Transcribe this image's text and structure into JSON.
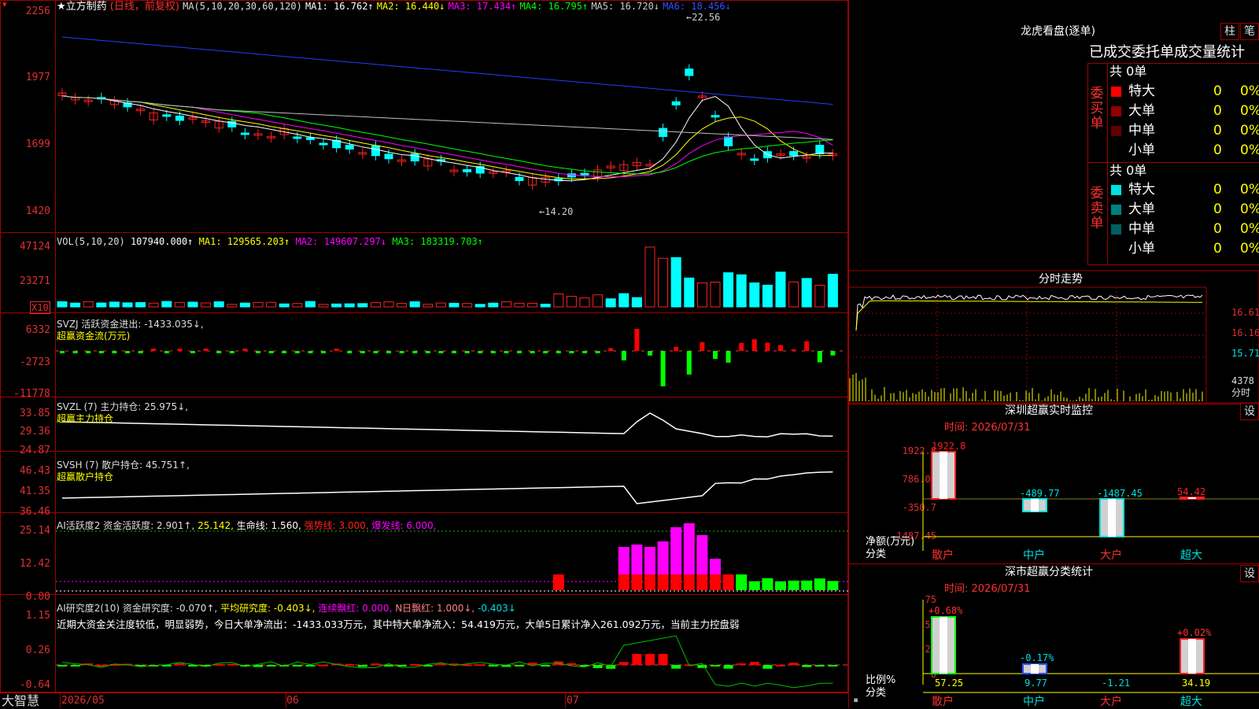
{
  "main_header": {
    "title": "★立方制药",
    "mode": "(日线，前复权)",
    "ma_name": "MA(5,10,20,30,60,120)",
    "ma1": "MA1: 16.762↑",
    "ma2": "MA2: 16.440↓",
    "ma3": "MA3: 17.434↑",
    "ma4": "MA4: 16.795↑",
    "ma5": "MA5: 16.720↓",
    "ma6": "MA6: 18.456↓",
    "high_mark": "22.56",
    "low_mark": "←14.20",
    "y_labels": [
      "2256",
      "1977",
      "1699",
      "1420"
    ]
  },
  "vol_panel": {
    "name": "VOL(5,10,20)",
    "val": "107940.000↑",
    "ma1": "MA1: 129565.203↑",
    "ma2": "MA2: 149607.297↓",
    "ma3": "MA3: 183319.703↑",
    "y_labels": [
      "47124",
      "23271"
    ],
    "unit": "X10"
  },
  "svzj_panel": {
    "line1": "SVZJ  活跃资金进出: -1433.035↓,",
    "line2": "超赢资金流(万元)",
    "y_labels": [
      "6332",
      "-2723",
      "-11778"
    ]
  },
  "svzl_panel": {
    "line1": "SVZL (7) 主力持仓: 25.975↓,",
    "line2": "超赢主力持仓",
    "y_labels": [
      "33.85",
      "29.36",
      "24.87"
    ]
  },
  "svsh_panel": {
    "line1": "SVSH (7) 散户持仓: 45.751↑,",
    "line2": "超赢散户持仓",
    "y_labels": [
      "46.43",
      "41.35",
      "36.46"
    ]
  },
  "ai1_panel": {
    "name": "AI活跃度2 资金活跃度: 2.901↑,",
    "v2": "25.142,",
    "v3": "生命线: 1.560,",
    "v4": "强势线: 3.000,",
    "v5": "爆发线: 6.000,",
    "y_labels": [
      "25.14",
      "12.42",
      "0.00"
    ]
  },
  "ai2_panel": {
    "name": "AI研究度2(10) 资金研究度: -0.070↑,",
    "v2": "平均研究度: -0.403↓,",
    "v3": "连续飘红: 0.000,",
    "v4": "N日飘红: 1.000↓,",
    "v5": "-0.403↓",
    "comment": "近期大资金关注度较低，明显弱势，今日大单净流出：-1433.033万元，其中特大单净流入：54.419万元，大单5日累计净入261.092万元，当前主力控盘弱",
    "y_labels": [
      "1.15",
      "0.26",
      "-0.64"
    ]
  },
  "bottom_bar": {
    "brand": "大智慧",
    "dates": [
      "2026/05",
      "06",
      "07"
    ]
  },
  "lhb": {
    "title": "龙虎看盘(逐单)",
    "btn1": "柱",
    "btn2": "笔",
    "subtitle": "已成交委托单成交量统计",
    "buy_side": "委买单",
    "sell_side": "委卖单",
    "buy_total": "共 0单",
    "sell_total": "共 0单",
    "buy_rows": [
      {
        "label": "特大",
        "n": "0",
        "p": "0%",
        "color": "#ff0000"
      },
      {
        "label": "大单",
        "n": "0",
        "p": "0%",
        "color": "#900000"
      },
      {
        "label": "中单",
        "n": "0",
        "p": "0%",
        "color": "#600000"
      },
      {
        "label": "小单",
        "n": "0",
        "p": "0%",
        "color": "#000000"
      }
    ],
    "sell_rows": [
      {
        "label": "特大",
        "n": "0",
        "p": "0%",
        "color": "#00e0e0"
      },
      {
        "label": "大单",
        "n": "0",
        "p": "0%",
        "color": "#008080"
      },
      {
        "label": "中单",
        "n": "0",
        "p": "0%",
        "color": "#006060"
      },
      {
        "label": "小单",
        "n": "0",
        "p": "0%",
        "color": "#000000"
      }
    ]
  },
  "minute": {
    "title": "分时走势",
    "y_labels": [
      "16.61",
      "16.16",
      "15.71"
    ],
    "vol_label": "4378",
    "unit": "分时"
  },
  "monitor": {
    "title": "深圳超赢实时监控",
    "btn": "设",
    "time": "时间: 2026/07/31",
    "y_labels": [
      "1922.8",
      "786.05",
      "-350.7",
      "-1487.45"
    ],
    "values": [
      "1922.8",
      "-489.77",
      "-1487.45",
      "54.42"
    ],
    "categories": [
      "散户",
      "中户",
      "大户",
      "超大"
    ],
    "axis_label1": "净额(万元)",
    "axis_label2": "分类"
  },
  "classify": {
    "title": "深市超赢分类统计",
    "btn": "设",
    "time": "时间: 2026/07/31",
    "y_labels": [
      "75",
      "50",
      "25",
      "0"
    ],
    "pcts": [
      "+0.68%",
      "-0.17%",
      "+0.02%"
    ],
    "values": [
      "57.25",
      "9.77",
      "-1.21",
      "34.19"
    ],
    "categories": [
      "散户",
      "中户",
      "大户",
      "超大"
    ],
    "axis_label1": "比例%",
    "axis_label2": "分类"
  }
}
